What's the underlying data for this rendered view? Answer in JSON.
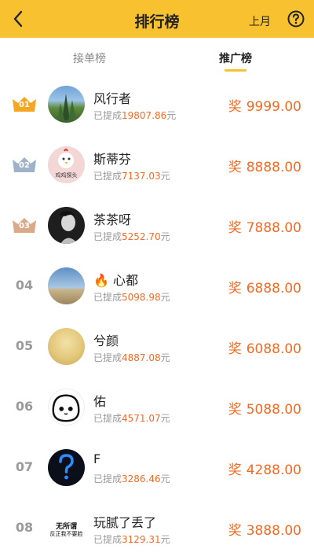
{
  "header": {
    "title": "排行榜",
    "period": "上月"
  },
  "tabs": [
    {
      "label": "接单榜"
    },
    {
      "label": "推广榜"
    }
  ],
  "withdraw_label": "已提成",
  "currency_suffix": "元",
  "prize_label": "奖",
  "entries": [
    {
      "rank": "01",
      "name": "风行者",
      "amount": "19807.86",
      "prize": "9999.00"
    },
    {
      "rank": "02",
      "name": "斯蒂芬",
      "amount": "7137.03",
      "prize": "8888.00",
      "avatar_text": "鸡鸡探头"
    },
    {
      "rank": "03",
      "name": "茶茶呀",
      "amount": "5252.70",
      "prize": "7888.00"
    },
    {
      "rank": "04",
      "name": "🔥 心都",
      "amount": "5098.98",
      "prize": "6888.00"
    },
    {
      "rank": "05",
      "name": "兮颜",
      "amount": "4887.08",
      "prize": "6088.00"
    },
    {
      "rank": "06",
      "name": "佑",
      "amount": "4571.07",
      "prize": "5088.00"
    },
    {
      "rank": "07",
      "name": "F",
      "amount": "3286.46",
      "prize": "4288.00"
    },
    {
      "rank": "08",
      "name": "玩腻了丢了",
      "amount": "3129.31",
      "prize": "3888.00",
      "avatar_text_1": "无所谓",
      "avatar_text_2": "反正我不要脸"
    }
  ],
  "colors": {
    "header": "#f7c12f",
    "accent": "#f26b25",
    "gold": "#f5a623",
    "silver": "#9fb3c8",
    "bronze": "#d9a98a"
  }
}
